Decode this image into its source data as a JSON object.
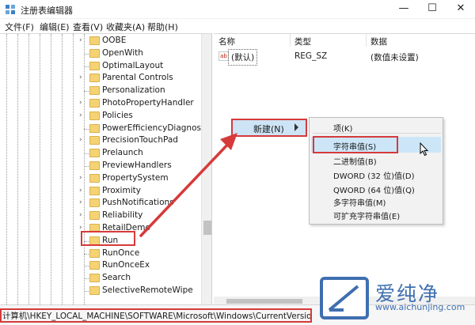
{
  "window": {
    "title": "注册表编辑器",
    "minimize": "—",
    "maximize": "☐",
    "close": "✕"
  },
  "menu": [
    "文件(F)",
    "编辑(E)",
    "查看(V)",
    "收藏夹(A)",
    "帮助(H)"
  ],
  "tree": {
    "items": [
      {
        "label": "OOBE",
        "expandable": true
      },
      {
        "label": "OpenWith",
        "expandable": false
      },
      {
        "label": "OptimalLayout",
        "expandable": false
      },
      {
        "label": "Parental Controls",
        "expandable": true
      },
      {
        "label": "Personalization",
        "expandable": false
      },
      {
        "label": "PhotoPropertyHandler",
        "expandable": true
      },
      {
        "label": "Policies",
        "expandable": true
      },
      {
        "label": "PowerEfficiencyDiagnostics",
        "expandable": false
      },
      {
        "label": "PrecisionTouchPad",
        "expandable": true
      },
      {
        "label": "Prelaunch",
        "expandable": false
      },
      {
        "label": "PreviewHandlers",
        "expandable": false
      },
      {
        "label": "PropertySystem",
        "expandable": true
      },
      {
        "label": "Proximity",
        "expandable": true
      },
      {
        "label": "PushNotifications",
        "expandable": true
      },
      {
        "label": "Reliability",
        "expandable": true
      },
      {
        "label": "RetailDemo",
        "expandable": true
      },
      {
        "label": "Run",
        "expandable": false,
        "selected": true
      },
      {
        "label": "RunOnce",
        "expandable": false
      },
      {
        "label": "RunOnceEx",
        "expandable": false
      },
      {
        "label": "Search",
        "expandable": false
      },
      {
        "label": "SelectiveRemoteWipe",
        "expandable": false
      }
    ]
  },
  "list": {
    "columns": [
      "名称",
      "类型",
      "数据"
    ],
    "rows": [
      {
        "name": "(默认)",
        "type": "REG_SZ",
        "data": "(数值未设置)"
      }
    ]
  },
  "context_menu": {
    "new_label": "新建(N)"
  },
  "submenu": {
    "items": [
      "项(K)",
      "字符串值(S)",
      "二进制值(B)",
      "DWORD (32 位)值(D)",
      "QWORD (64 位)值(Q)",
      "多字符串值(M)",
      "可扩充字符串值(E)"
    ],
    "highlighted_index": 1
  },
  "statusbar": {
    "path": "计算机\\HKEY_LOCAL_MACHINE\\SOFTWARE\\Microsoft\\Windows\\CurrentVersion\\Run"
  },
  "watermark": {
    "name": "爱纯净",
    "url": "www.aichunjing.com"
  },
  "colors": {
    "annotation_red": "#d63a3a",
    "highlight_blue": "#cce6f8",
    "folder_yellow": "#f5d274",
    "watermark_blue": "#3f6fb0"
  }
}
